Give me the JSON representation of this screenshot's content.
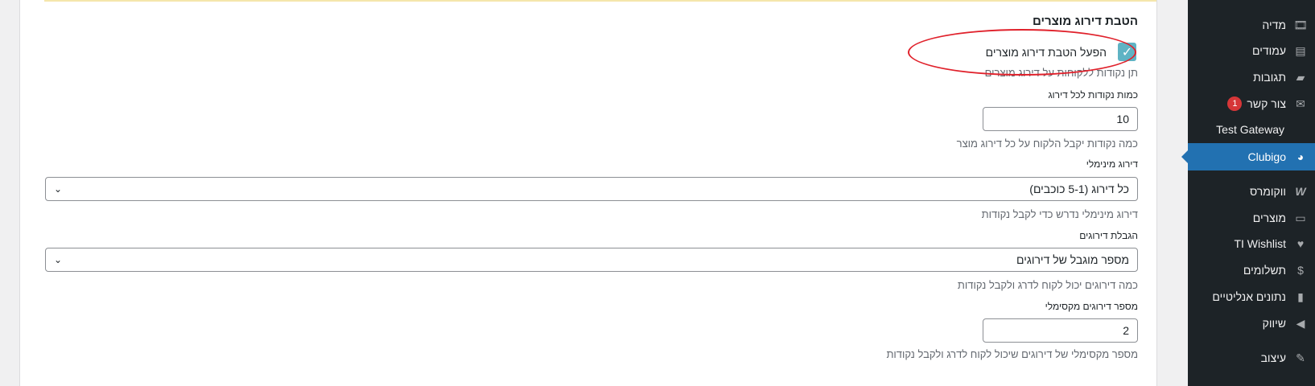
{
  "sidebar": {
    "items": [
      {
        "label": "מדיה",
        "icon": "media-icon"
      },
      {
        "label": "עמודים",
        "icon": "pages-icon"
      },
      {
        "label": "תגובות",
        "icon": "comments-icon"
      },
      {
        "label": "צור קשר",
        "icon": "mail-icon",
        "badge": "1"
      },
      {
        "label": "Test Gateway",
        "icon": ""
      },
      {
        "label": "Clubigo",
        "icon": "clubigo-icon",
        "active": true
      },
      {
        "label": "ווקומרס",
        "icon": "woocommerce-icon"
      },
      {
        "label": "מוצרים",
        "icon": "products-icon"
      },
      {
        "label": "TI Wishlist",
        "icon": "wishlist-heart-icon"
      },
      {
        "label": "תשלומים",
        "icon": "payments-icon"
      },
      {
        "label": "נתונים אנליטיים",
        "icon": "analytics-icon"
      },
      {
        "label": "שיווק",
        "icon": "marketing-megaphone-icon"
      },
      {
        "label": "עיצוב",
        "icon": "appearance-brush-icon"
      }
    ],
    "accent_color": "#2271b1"
  },
  "form": {
    "section_title": "הטבת דירוג מוצרים",
    "enable_label": "הפעל הטבת דירוג מוצרים",
    "enable_checked": true,
    "enable_help": "תן נקודות ללקוחות על דירוג מוצרים",
    "points_label": "כמות נקודות לכל דירוג",
    "points_value": "10",
    "points_help": "כמה נקודות יקבל הלקוח על כל דירוג מוצר",
    "min_rating_label": "דירוג מינימלי",
    "min_rating_value": "כל דירוג (5-1 כוכבים)",
    "min_rating_help": "דירוג מינימלי נדרש כדי לקבל נקודות",
    "limit_label": "הגבלת דירוגים",
    "limit_value": "מספר מוגבל של דירוגים",
    "limit_help": "כמה דירוגים יכול לקוח לדרג ולקבל נקודות",
    "max_label": "מספר דירוגים מקסימלי",
    "max_value": "2",
    "max_help": "מספר מקסימלי של דירוגים שיכול לקוח לדרג ולקבל נקודות"
  },
  "annotation_color": "#e0212b"
}
